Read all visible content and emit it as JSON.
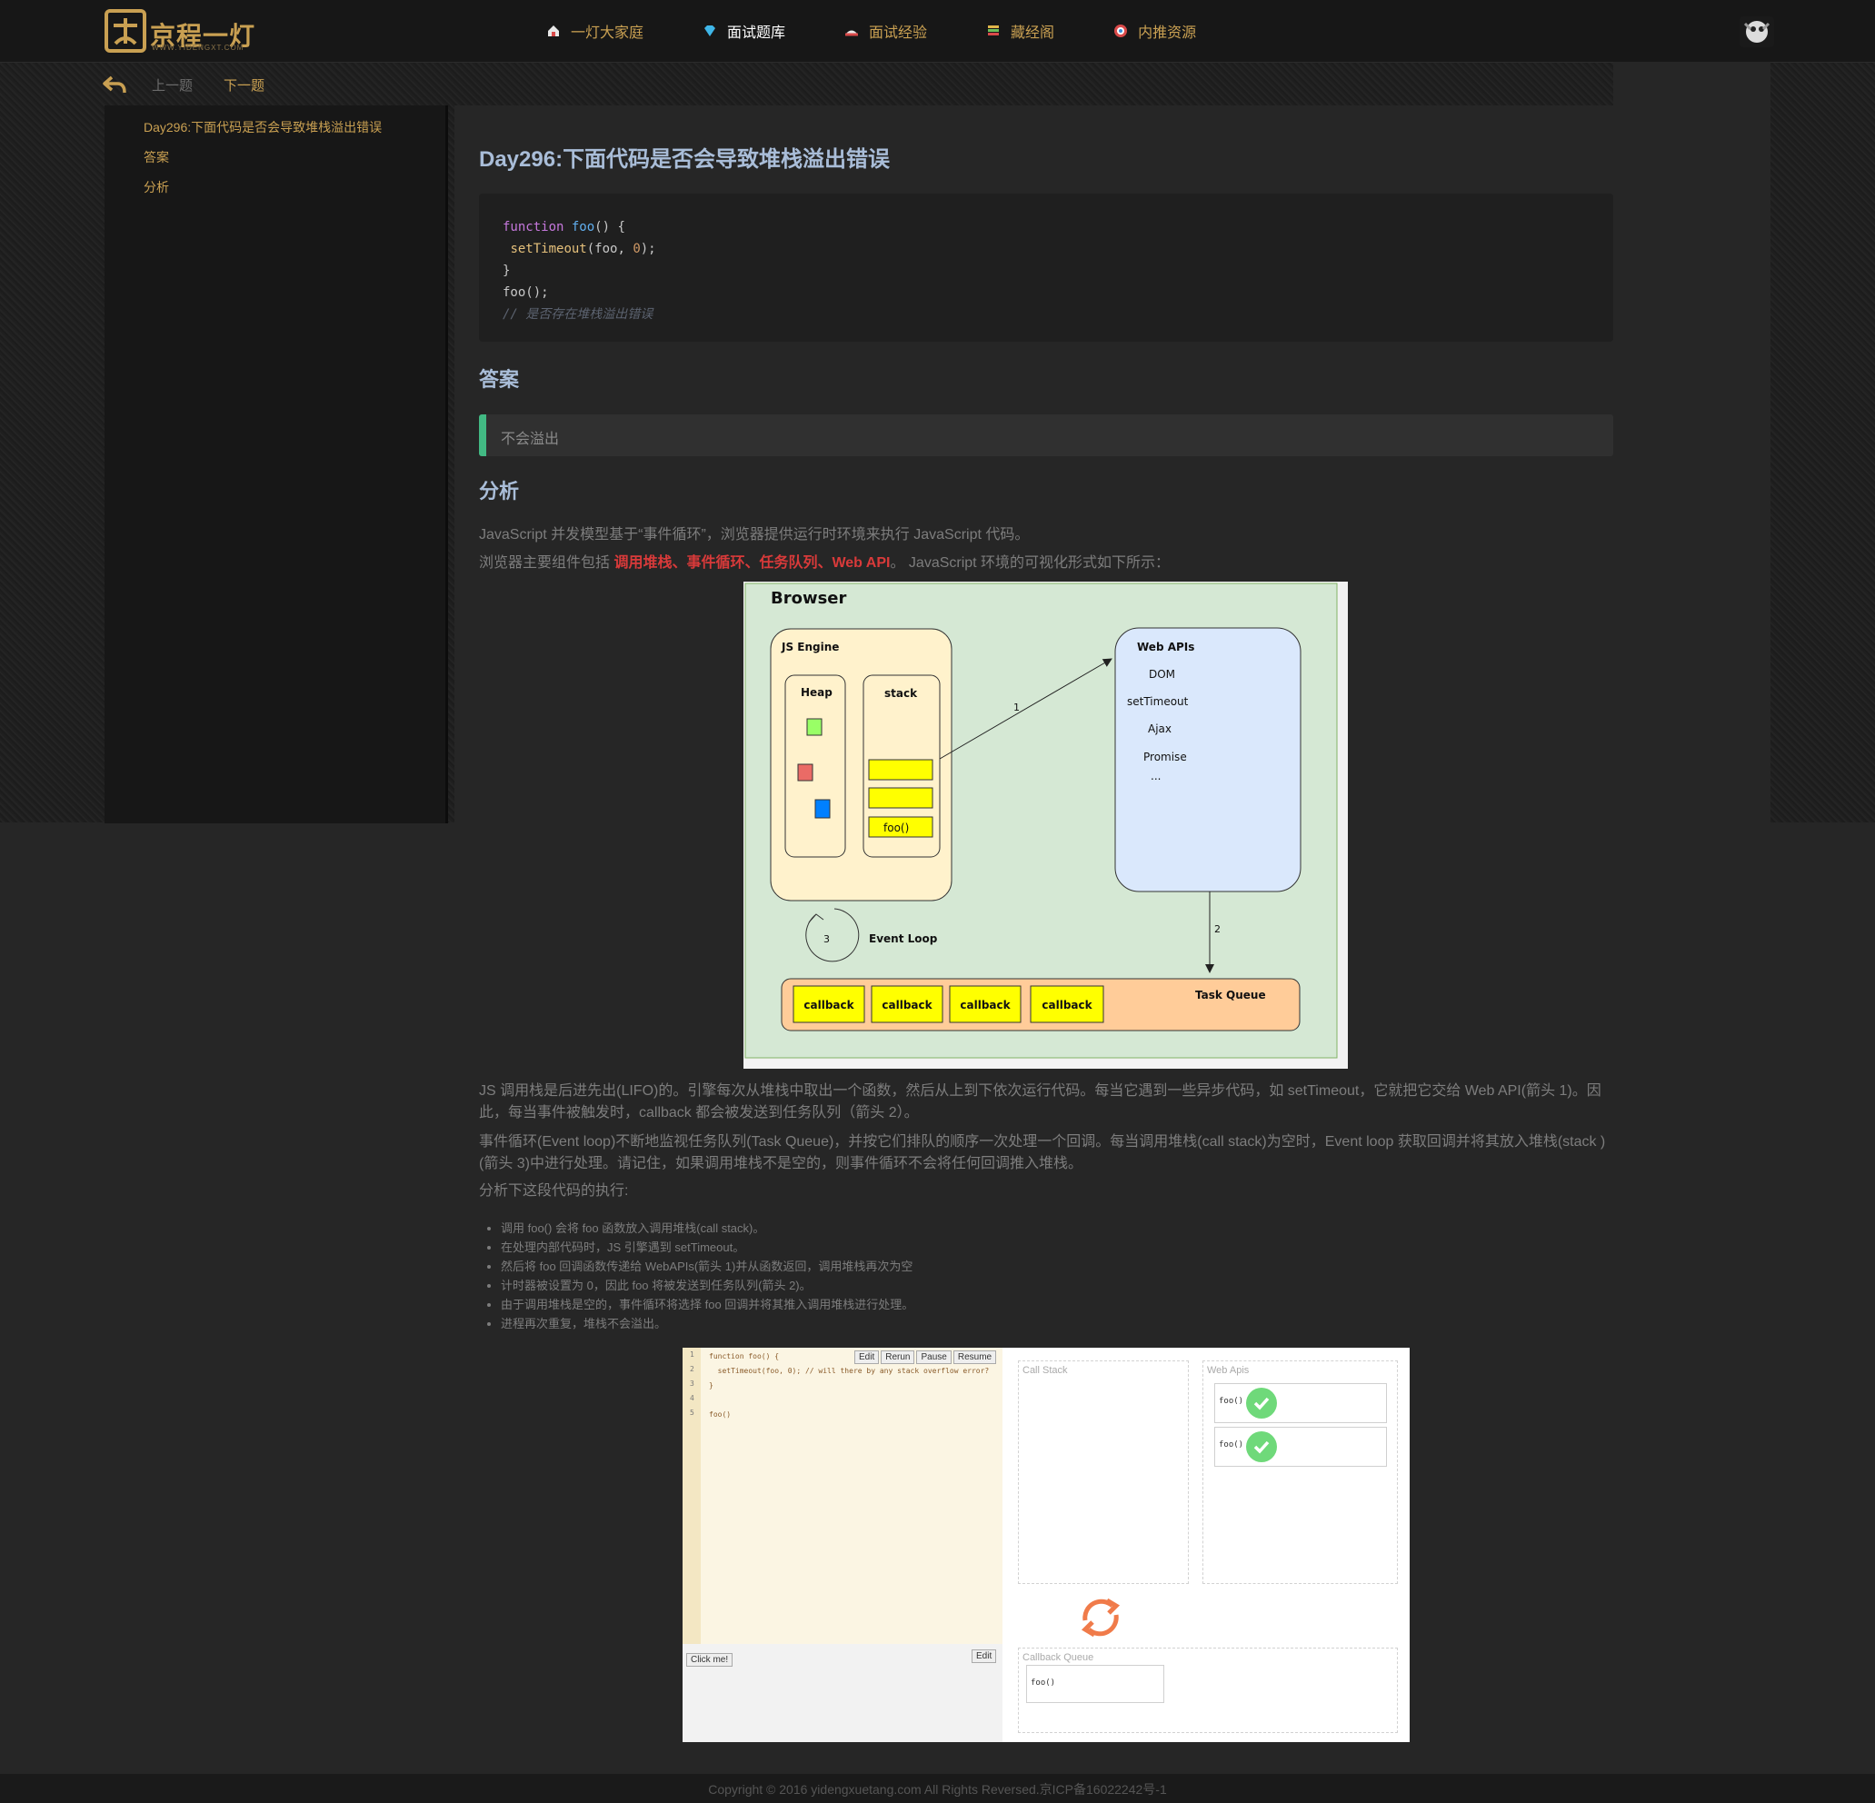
{
  "header": {
    "logo_text": "京程一灯",
    "logo_subtext": "WWW.YIDENGXT.COM",
    "nav": [
      {
        "label": "一灯大家庭",
        "icon": "home-icon"
      },
      {
        "label": "面试题库",
        "icon": "diamond-icon"
      },
      {
        "label": "面试经验",
        "icon": "hat-icon"
      },
      {
        "label": "藏经阁",
        "icon": "books-icon"
      },
      {
        "label": "内推资源",
        "icon": "target-icon"
      }
    ],
    "active_nav": "面试题库",
    "avatar": "avatar-image"
  },
  "pager": {
    "prev": "上一题",
    "next": "下一题"
  },
  "toc": [
    "Day296:下面代码是否会导致堆栈溢出错误",
    "答案",
    "分析"
  ],
  "article": {
    "title": "Day296:下面代码是否会导致堆栈溢出错误",
    "code_lines": [
      "function foo() {",
      " setTimeout(foo, 0);",
      "}",
      "foo();",
      "// 是否存在堆栈溢出错误"
    ],
    "answer_heading": "答案",
    "answer_text": "不会溢出",
    "analysis_heading": "分析",
    "intro1": "JavaScript 并发模型基于“事件循环”，浏览器提供运行时环境来执行 JavaScript 代码。",
    "intro2_pre": "浏览器主要组件包括 ",
    "intro2_red": "调用堆栈、事件循环、任务队列、Web API",
    "intro2_post": "。 JavaScript 环境的可视化形式如下所示：",
    "p_stack": "JS 调用栈是后进先出(LIFO)的。引擎每次从堆栈中取出一个函数，然后从上到下依次运行代码。每当它遇到一些异步代码，如 setTimeout，它就把它交给 Web API(箭头 1)。因此，每当事件被触发时，callback 都会被发送到任务队列（箭头 2）。",
    "p_loop": "事件循环(Event loop)不断地监视任务队列(Task Queue)，并按它们排队的顺序一次处理一个回调。每当调用堆栈(call stack)为空时，Event loop 获取回调并将其放入堆栈(stack )(箭头 3)中进行处理。请记住，如果调用堆栈不是空的，则事件循环不会将任何回调推入堆栈。",
    "p_exec": "分析下这段代码的执行:",
    "steps": [
      "调用 foo() 会将 foo 函数放入调用堆栈(call stack)。",
      "在处理内部代码时，JS 引擎遇到 setTimeout。",
      "然后将 foo 回调函数传递给 WebAPIs(箭头 1)并从函数返回，调用堆栈再次为空",
      "计时器被设置为 0，因此 foo 将被发送到任务队列(箭头 2)。",
      "由于调用堆栈是空的，事件循环将选择 foo 回调并将其推入调用堆栈进行处理。",
      "进程再次重复，堆栈不会溢出。"
    ]
  },
  "diagram": {
    "browser": "Browser",
    "js_engine": "JS Engine",
    "heap": "Heap",
    "stack": "stack",
    "stack_top": "foo()",
    "web_apis": "Web APIs",
    "web_api_items": [
      "DOM",
      "setTimeout",
      "Ajax",
      "Promise",
      "..."
    ],
    "arrow1": "1",
    "arrow2": "2",
    "arrow3": "3",
    "event_loop": "Event Loop",
    "task_queue": "Task Queue",
    "callbacks": [
      "callback",
      "callback",
      "callback",
      "callback"
    ],
    "colors": {
      "bg": "#d5e8d4",
      "engine": "#fff2cc",
      "webapis": "#dae8fc",
      "queue": "#ffcc99",
      "yellow": "#ffff00"
    }
  },
  "loupe": {
    "editor_lines": [
      "function foo() {",
      "  setTimeout(foo, 0); // will there by any stack overflow error?",
      "}",
      "",
      "foo()"
    ],
    "line_numbers": [
      "1",
      "2",
      "3",
      "4",
      "5"
    ],
    "buttons": [
      "Edit",
      "Rerun",
      "Pause",
      "Resume"
    ],
    "click_me": "Click me!",
    "console_edit": "Edit",
    "call_stack": "Call Stack",
    "web_apis": "Web Apis",
    "web_api_items": [
      "foo()",
      "foo()"
    ],
    "callback_queue": "Callback Queue",
    "queue_items": [
      "foo()"
    ]
  },
  "footer": "Copyright © 2016 yidengxuetang.com All Rights Reversed.京ICP备16022242号-1"
}
